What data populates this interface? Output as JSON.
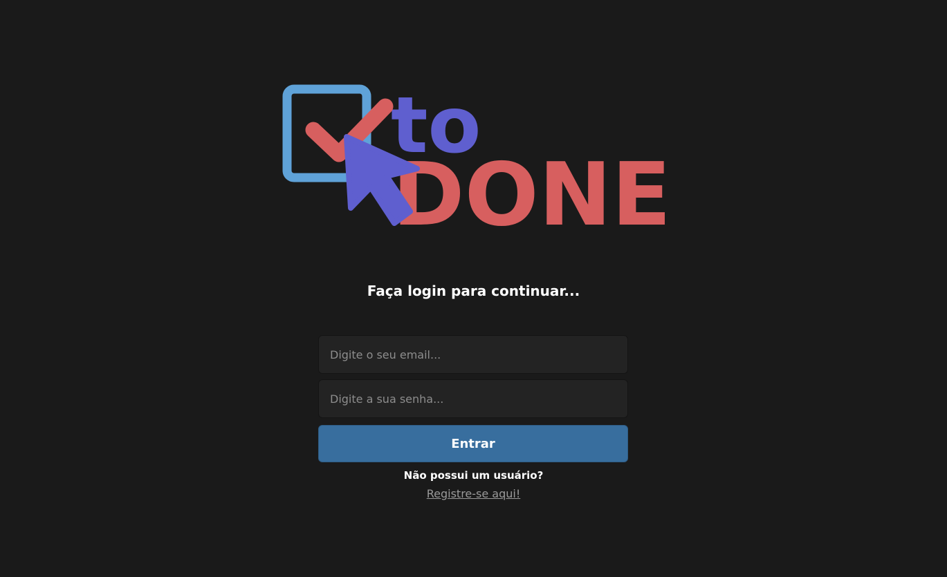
{
  "logo": {
    "word_top": "to",
    "word_bottom": "DONE",
    "icons": [
      "checkbox-icon",
      "checkmark-icon",
      "cursor-arrow-icon"
    ]
  },
  "colors": {
    "background": "#1a1a1a",
    "checkbox_blue": "#5fa2d8",
    "check_red": "#d75f5f",
    "purple": "#5f5fcf",
    "button_blue": "#386e9e",
    "link_gray": "#9a9a9a"
  },
  "login": {
    "title": "Faça login para continuar...",
    "email_placeholder": "Digite o seu email...",
    "password_placeholder": "Digite a sua senha...",
    "submit_label": "Entrar",
    "no_account_text": "Não possui um usuário?",
    "register_link": "Registre-se aqui!"
  }
}
